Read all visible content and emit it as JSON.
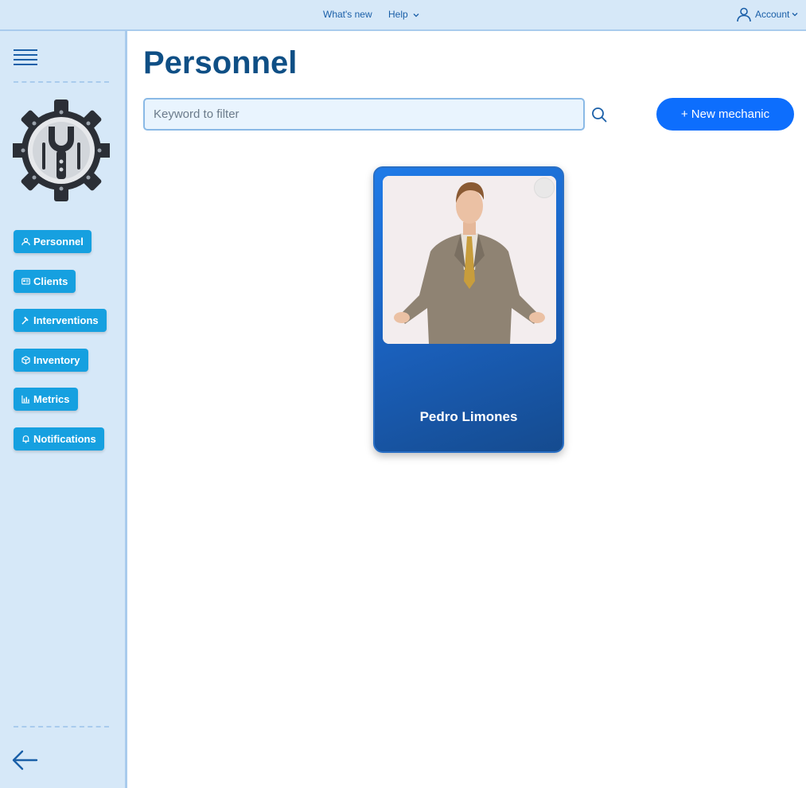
{
  "topbar": {
    "whats_new": "What's new",
    "help": "Help",
    "account": "Account"
  },
  "sidebar": {
    "items": [
      {
        "label": "Personnel",
        "icon": "personnel-icon"
      },
      {
        "label": "Clients",
        "icon": "id-card-icon"
      },
      {
        "label": "Interventions",
        "icon": "hammer-icon"
      },
      {
        "label": "Inventory",
        "icon": "box-icon"
      },
      {
        "label": "Metrics",
        "icon": "bar-chart-icon"
      },
      {
        "label": "Notifications",
        "icon": "bell-icon"
      }
    ]
  },
  "main": {
    "title": "Personnel",
    "search": {
      "placeholder": "Keyword to filter",
      "value": ""
    },
    "new_button": "+ New mechanic",
    "cards": [
      {
        "name": "Pedro Limones"
      }
    ]
  },
  "colors": {
    "accent": "#0d6efd",
    "nav_button": "#16a0e0",
    "sidebar_bg": "#d6e8f8",
    "title": "#0f4f85"
  }
}
